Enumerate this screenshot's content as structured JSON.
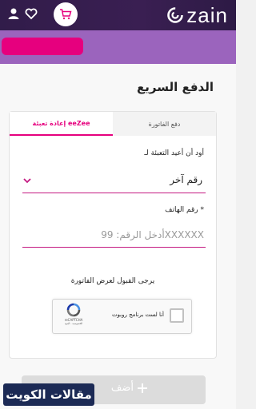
{
  "header": {
    "logo_text": "zain",
    "colors": {
      "bar": "#311c4a",
      "accent": "#e6007e"
    }
  },
  "page": {
    "title": "الدفع السريع"
  },
  "tabs": [
    {
      "label": "إعادة تعبئة eeZee",
      "active": true
    },
    {
      "label": "دفع الفاتورة",
      "active": false
    }
  ],
  "form": {
    "recharge_for_label": "أود أن أعيد التعبئة لـ",
    "recharge_for_value": "رقم آخر",
    "phone_label": "رقم الهاتف *",
    "phone_placeholder": "أدخل الرقم: 99XXXXXX",
    "accept_text": "يرجى القبول لعرض الفاتورة"
  },
  "captcha": {
    "checkbox_text": "أنا لست برنامج روبوت",
    "brand": "reCAPTCHA",
    "privacy": "الخصوصية - البنود"
  },
  "add_button": {
    "label": "أضف"
  },
  "watermark": {
    "text": "مقالات الكويت"
  }
}
